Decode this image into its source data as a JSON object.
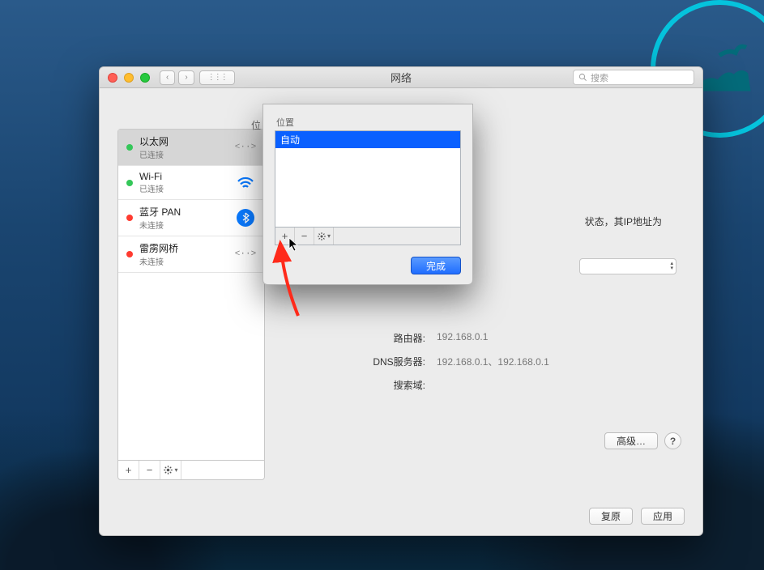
{
  "window": {
    "title": "网络",
    "search_placeholder": "搜索"
  },
  "location_truncated": "位",
  "locations_sheet": {
    "label": "位置",
    "items": [
      "自动"
    ],
    "selected": 0,
    "done_button": "完成"
  },
  "sidebar": {
    "services": [
      {
        "name": "以太网",
        "status": "已连接",
        "dot": "green",
        "icon": "link"
      },
      {
        "name": "Wi-Fi",
        "status": "已连接",
        "dot": "green",
        "icon": "wifi"
      },
      {
        "name": "蓝牙 PAN",
        "status": "未连接",
        "dot": "red",
        "icon": "bluetooth"
      },
      {
        "name": "雷雳网桥",
        "status": "未连接",
        "dot": "red",
        "icon": "link"
      }
    ]
  },
  "main": {
    "status_fragment": "状态，其IP地址为",
    "rows": {
      "router_label": "路由器:",
      "router_value": "192.168.0.1",
      "dns_label": "DNS服务器:",
      "dns_value": "192.168.0.1、192.168.0.1",
      "search_domain_label": "搜索域:",
      "search_domain_value": ""
    },
    "advanced_button": "高级…"
  },
  "footer": {
    "restore": "复原",
    "apply": "应用"
  },
  "icons": {
    "plus": "+",
    "minus": "−",
    "gear": "gear",
    "help": "?",
    "chevron_left": "‹",
    "chevron_right": "›",
    "grid": "⋮⋮⋮"
  },
  "colors": {
    "accent_blue": "#0a60ff",
    "status_green": "#34c759",
    "status_red": "#ff3b30"
  }
}
